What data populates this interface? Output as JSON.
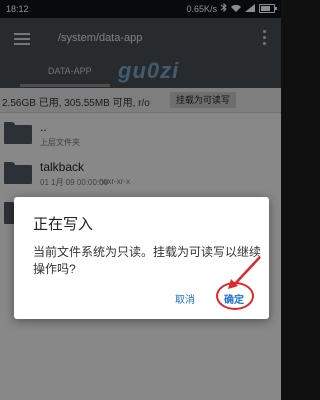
{
  "status_bar": {
    "time": "18:12",
    "network_speed": "0.65K/s",
    "icons": [
      "bluetooth-icon",
      "wifi-icon",
      "signal-icon",
      "battery-icon"
    ]
  },
  "app_bar": {
    "path": "/system/data-app",
    "tabs": [
      {
        "label": "DATA-APP"
      }
    ],
    "watermark": "gu0zi"
  },
  "info_bar": {
    "storage_text": "2.56GB 已用, 305.55MB 可用, r/o",
    "mount_button_label": "挂载为可读写"
  },
  "file_list": {
    "items": [
      {
        "name": "..",
        "subtitle": "上层文件夹",
        "permissions": "",
        "icon": "folder-icon"
      },
      {
        "name": "talkback",
        "subtitle": "01 1月 09 00:00:00",
        "permissions": "rwxr-xr-x",
        "icon": "folder-icon"
      }
    ]
  },
  "dialog": {
    "title": "正在写入",
    "message": "当前文件系统为只读。挂载为可读写以继续操作吗?",
    "cancel_label": "取消",
    "confirm_label": "确定"
  },
  "colors": {
    "app_bar": "#4a4f53",
    "dialog_button": "#1e73d2",
    "annotation": "#e02828"
  }
}
